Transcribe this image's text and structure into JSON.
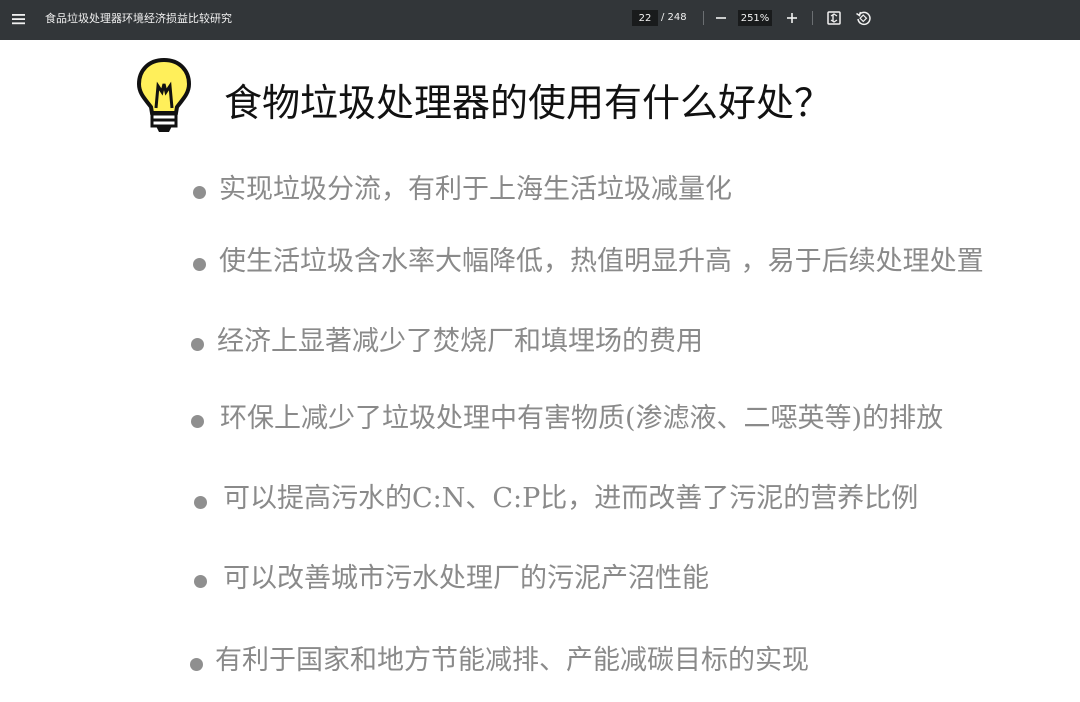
{
  "toolbar": {
    "title": "食品垃圾处理器环境经济损益比较研究",
    "page_current": "22",
    "page_total": "/ 248",
    "zoom": "251%",
    "icons": [
      "menu-icon",
      "minus-icon",
      "plus-icon",
      "fit-page-icon",
      "rotate-icon"
    ]
  },
  "slide": {
    "title": "食物垃圾处理器的使用有什么好处？",
    "bullets": [
      "实现垃圾分流，有利于上海生活垃圾减量化",
      "使生活垃圾含水率大幅降低，热值明显升高 ，易于后续处理处置",
      "经济上显著减少了焚烧厂和填埋场的费用",
      "环保上减少了垃圾处理中有害物质(渗滤液、二噁英等)的排放",
      "可以提高污水的C:N、C:P比，进而改善了污泥的营养比例",
      "可以改善城市污水处理厂的污泥产沼性能",
      "有利于国家和地方节能减排、产能减碳目标的实现"
    ]
  },
  "colors": {
    "toolbar_bg": "#323639",
    "bullet_text": "#8a8a8a",
    "title_text": "#111111",
    "bulb_yellow": "#ffef5a"
  }
}
